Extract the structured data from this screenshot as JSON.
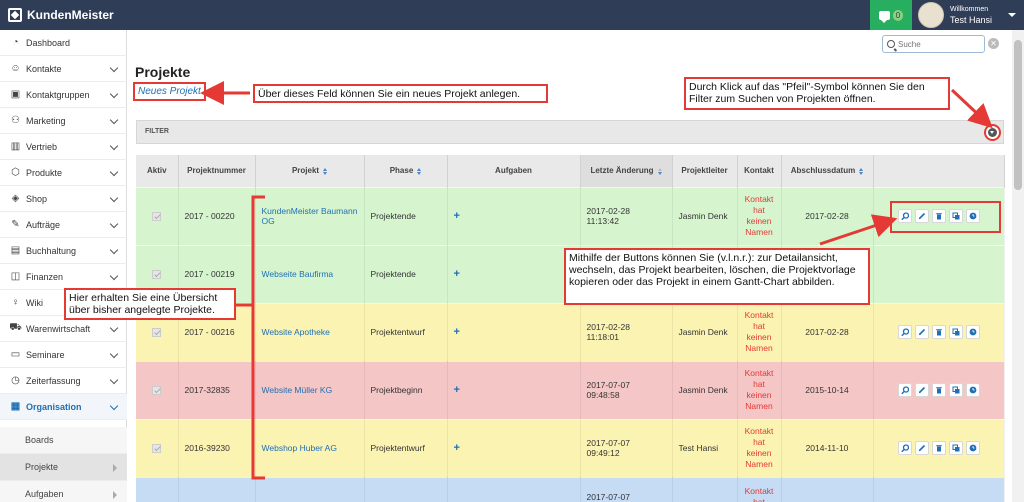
{
  "app": {
    "title": "KundenMeister",
    "chat_count": "0"
  },
  "user": {
    "welcome": "Willkommen",
    "name": "Test Hansi"
  },
  "search": {
    "placeholder": "Suche"
  },
  "sidebar": {
    "items": [
      {
        "label": "Dashboard",
        "icon": "dashboard-icon"
      },
      {
        "label": "Kontakte",
        "icon": "contacts-icon"
      },
      {
        "label": "Kontaktgruppen",
        "icon": "contact-groups-icon"
      },
      {
        "label": "Marketing",
        "icon": "marketing-icon"
      },
      {
        "label": "Vertrieb",
        "icon": "sales-icon"
      },
      {
        "label": "Produkte",
        "icon": "products-icon"
      },
      {
        "label": "Shop",
        "icon": "shop-icon"
      },
      {
        "label": "Aufträge",
        "icon": "orders-icon"
      },
      {
        "label": "Buchhaltung",
        "icon": "accounting-icon"
      },
      {
        "label": "Finanzen",
        "icon": "finance-icon"
      },
      {
        "label": "Wiki",
        "icon": "wiki-icon"
      },
      {
        "label": "Warenwirtschaft",
        "icon": "inventory-icon"
      },
      {
        "label": "Seminare",
        "icon": "seminars-icon"
      },
      {
        "label": "Zeiterfassung",
        "icon": "time-tracking-icon"
      },
      {
        "label": "Organisation",
        "icon": "organisation-icon"
      }
    ],
    "sub_items": [
      {
        "label": "Boards"
      },
      {
        "label": "Projekte"
      },
      {
        "label": "Aufgaben"
      }
    ]
  },
  "page": {
    "title": "Projekte",
    "new_project": "Neues Projekt"
  },
  "callouts": {
    "new_project": "Über dieses Feld können Sie ein neues Projekt anlegen.",
    "filter": "Durch Klick auf das \"Pfeil\"-Symbol können Sie den Filter zum Suchen von Projekten öffnen.",
    "overview": "Hier erhalten Sie eine Übersicht über bisher angelegte Projekte.",
    "buttons": "Mithilfe der Buttons können Sie (v.l.n.r.): zur Detailansicht, wechseln, das Projekt bearbeiten, löschen, die Projektvorlage kopieren oder das Projekt in einem Gantt-Chart abbilden."
  },
  "filter": {
    "label": "FILTER"
  },
  "table": {
    "columns": [
      "Aktiv",
      "Projektnummer",
      "Projekt",
      "Phase",
      "Aufgaben",
      "Letzte Änderung",
      "Projektleiter",
      "Kontakt",
      "Abschlussdatum"
    ],
    "rows": [
      {
        "status": "green",
        "number": "2017 - 00220",
        "project": "KundenMeister Baumann OG",
        "phase": "Projektende",
        "changed_date": "2017-02-28",
        "changed_time": "11:13:42",
        "lead": "Jasmin Denk",
        "contact": "Kontakt hat keinen Namen",
        "close_date": "2017-02-28"
      },
      {
        "status": "green",
        "number": "2017 - 00219",
        "project": "Webseite Baufirma",
        "phase": "Projektende",
        "changed_date": "",
        "changed_time": "",
        "lead": "",
        "contact": "",
        "close_date": ""
      },
      {
        "status": "yellow",
        "number": "2017 - 00216",
        "project": "Website Apotheke",
        "phase": "Projektentwurf",
        "changed_date": "2017-02-28",
        "changed_time": "11:18:01",
        "lead": "Jasmin Denk",
        "contact": "Kontakt hat keinen Namen",
        "close_date": "2017-02-28"
      },
      {
        "status": "red",
        "number": "2017-32835",
        "project": "Website Müller KG",
        "phase": "Projektbeginn",
        "changed_date": "2017-07-07",
        "changed_time": "09:48:58",
        "lead": "Jasmin Denk",
        "contact": "Kontakt hat keinen Namen",
        "close_date": "2015-10-14"
      },
      {
        "status": "yellow",
        "number": "2016-39230",
        "project": "Webshop Huber AG",
        "phase": "Projektentwurf",
        "changed_date": "2017-07-07",
        "changed_time": "09:49:12",
        "lead": "Test Hansi",
        "contact": "Kontakt hat keinen Namen",
        "close_date": "2014-11-10"
      },
      {
        "status": "blue",
        "number": "",
        "project": "",
        "phase": "",
        "changed_date": "2017-07-07",
        "changed_time": "",
        "lead": "",
        "contact": "Kontakt hat",
        "close_date": ""
      }
    ]
  },
  "row_buttons": [
    "details-icon",
    "edit-icon",
    "delete-icon",
    "copy-icon",
    "gantt-icon"
  ],
  "colors": {
    "topbar": "#2f3d57",
    "accent": "#1f6fb5",
    "annotation": "#e53935",
    "green_row": "#d6f5cf",
    "yellow_row": "#fbf3b2",
    "red_row": "#f5c6c6"
  }
}
